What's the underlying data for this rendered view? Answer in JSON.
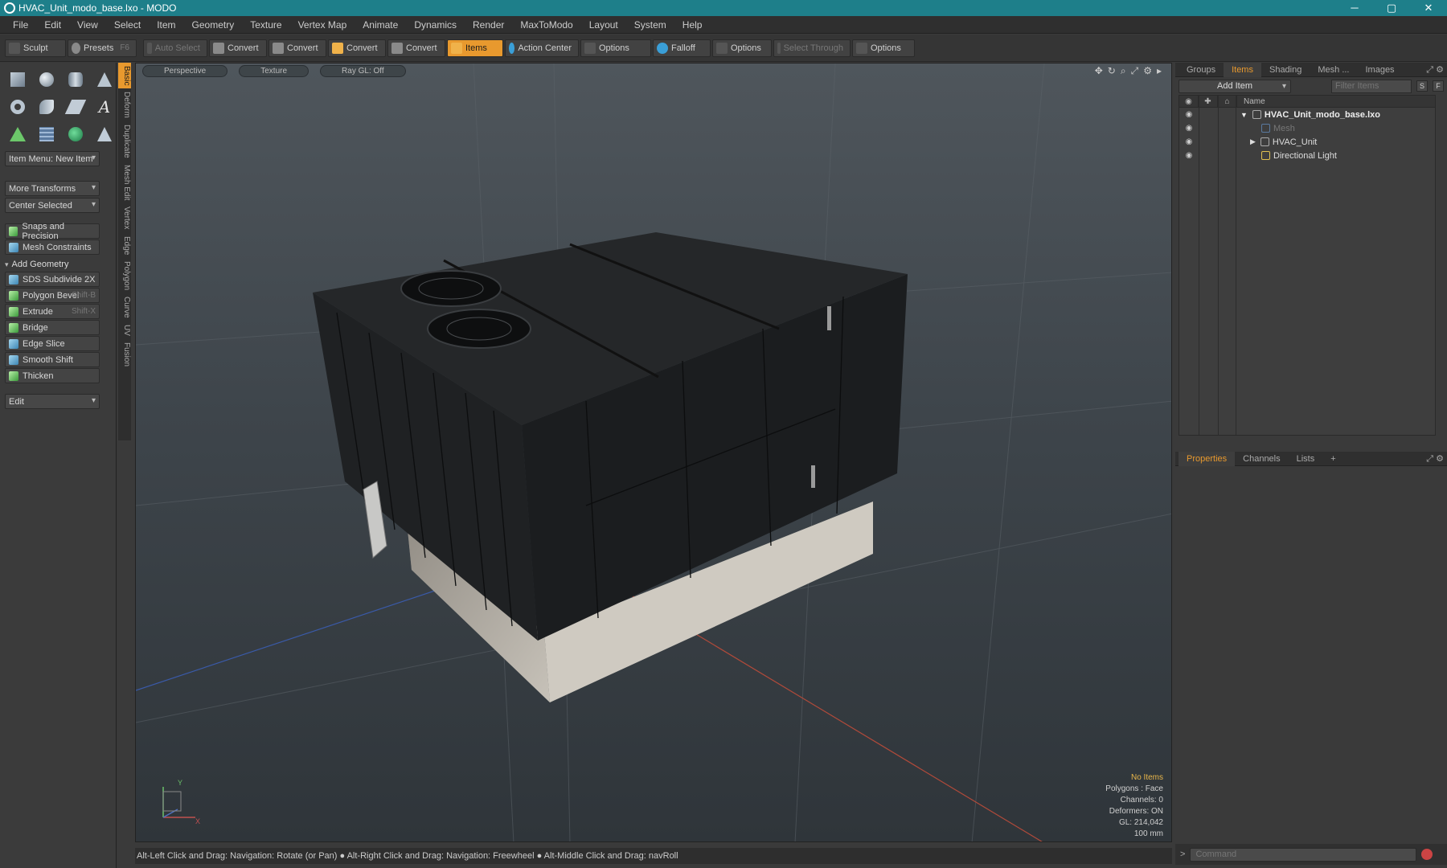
{
  "window": {
    "title": "HVAC_Unit_modo_base.lxo - MODO",
    "minimize": "─",
    "maximize": "▢",
    "close": "✕"
  },
  "menu": [
    "File",
    "Edit",
    "View",
    "Select",
    "Item",
    "Geometry",
    "Texture",
    "Vertex Map",
    "Animate",
    "Dynamics",
    "Render",
    "MaxToModo",
    "Layout",
    "System",
    "Help"
  ],
  "toolbar": {
    "sculpt": "Sculpt",
    "presets": "Presets",
    "presets_shortcut": "F6",
    "auto_select": "Auto Select",
    "convert1": "Convert",
    "convert2": "Convert",
    "convert3": "Convert",
    "convert4": "Convert",
    "items": "Items",
    "action_center": "Action Center",
    "options1": "Options",
    "falloff": "Falloff",
    "options2": "Options",
    "select_through": "Select Through",
    "options3": "Options"
  },
  "left_panel": {
    "item_menu": "Item Menu: New Item",
    "more_transforms": "More Transforms",
    "center_selected": "Center Selected",
    "snaps": "Snaps and Precision",
    "mesh_constraints": "Mesh Constraints",
    "add_geometry": "Add Geometry",
    "tools": [
      {
        "label": "SDS Subdivide 2X",
        "shortcut": ""
      },
      {
        "label": "Polygon Bevel",
        "shortcut": "Shift-B"
      },
      {
        "label": "Extrude",
        "shortcut": "Shift-X"
      },
      {
        "label": "Bridge",
        "shortcut": ""
      },
      {
        "label": "Edge Slice",
        "shortcut": ""
      },
      {
        "label": "Smooth Shift",
        "shortcut": ""
      },
      {
        "label": "Thicken",
        "shortcut": ""
      }
    ],
    "edit_dropdown": "Edit",
    "vtabs": [
      "Basic",
      "Deform",
      "Duplicate",
      "Mesh Edit",
      "Vertex",
      "Edge",
      "Polygon",
      "Curve",
      "UV",
      "Fusion"
    ]
  },
  "viewport": {
    "view": "Perspective",
    "shading": "Texture",
    "raygl": "Ray GL: Off",
    "info": {
      "selection": "No Items",
      "polygons": "Polygons : Face",
      "channels": "Channels: 0",
      "deformers": "Deformers: ON",
      "gl": "GL: 214,042",
      "scale": "100 mm"
    },
    "axis_y": "Y",
    "axis_x": "X"
  },
  "status": "Alt-Left Click and Drag: Navigation: Rotate (or Pan) ● Alt-Right Click and Drag: Navigation: Freewheel ● Alt-Middle Click and Drag: navRoll",
  "items_panel": {
    "tabs": [
      "Groups",
      "Items",
      "Shading",
      "Mesh ...",
      "Images"
    ],
    "add_item": "Add Item",
    "filter_placeholder": "Filter Items",
    "s_btn": "S",
    "f_btn": "F",
    "name_col": "Name",
    "tree": {
      "root": "HVAC_Unit_modo_base.lxo",
      "mesh": "Mesh",
      "hvac": "HVAC_Unit",
      "light": "Directional Light"
    }
  },
  "props_panel": {
    "tabs": [
      "Properties",
      "Channels",
      "Lists"
    ],
    "add_tab": "+"
  },
  "command": {
    "placeholder": "Command"
  }
}
